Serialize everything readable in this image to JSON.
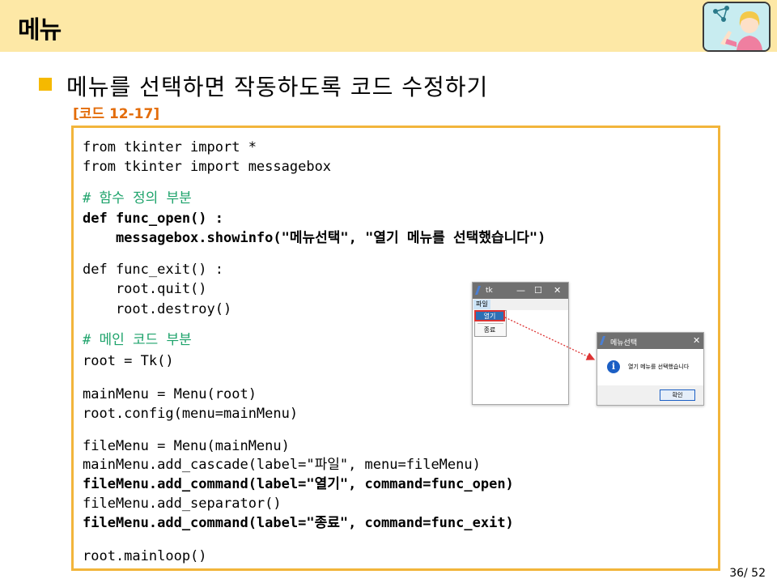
{
  "header": {
    "title": "메뉴"
  },
  "bullet": {
    "text": "메뉴를 선택하면 작동하도록 코드 수정하기"
  },
  "code_label": "[코드 12-17]",
  "code": {
    "l1": "from tkinter import *",
    "l2": "from tkinter import messagebox",
    "l3": "# 함수 정의 부분",
    "l4": "def func_open() :",
    "l5": "    messagebox.showinfo(\"메뉴선택\", \"열기 메뉴를 선택했습니다\")",
    "l6": "def func_exit() :",
    "l7": "    root.quit()",
    "l8": "    root.destroy()",
    "l9": "# 메인 코드 부분",
    "l10": "root = Tk()",
    "l11": "mainMenu = Menu(root)",
    "l12": "root.config(menu=mainMenu)",
    "l13": "fileMenu = Menu(mainMenu)",
    "l14": "mainMenu.add_cascade(label=\"파일\", menu=fileMenu)",
    "l15": "fileMenu.add_command(label=\"열기\", command=func_open)",
    "l16": "fileMenu.add_separator()",
    "l17": "fileMenu.add_command(label=\"종료\", command=func_exit)",
    "l18": "root.mainloop()"
  },
  "tk_window": {
    "title": "tk",
    "minimize": "—",
    "maximize": "☐",
    "close": "✕",
    "menu_file": "파일",
    "item_open": "열기",
    "item_exit": "종료"
  },
  "msg_window": {
    "title": "메뉴선택",
    "close": "✕",
    "icon_glyph": "i",
    "message": "열기 메뉴를 선택했습니다",
    "ok": "확인"
  },
  "page_number": "36/ 52",
  "colors": {
    "header_bg": "#fde8a6",
    "bullet": "#f5b900",
    "code_border": "#f2b53b",
    "label": "#e36c09",
    "comment": "#1ea36b"
  }
}
